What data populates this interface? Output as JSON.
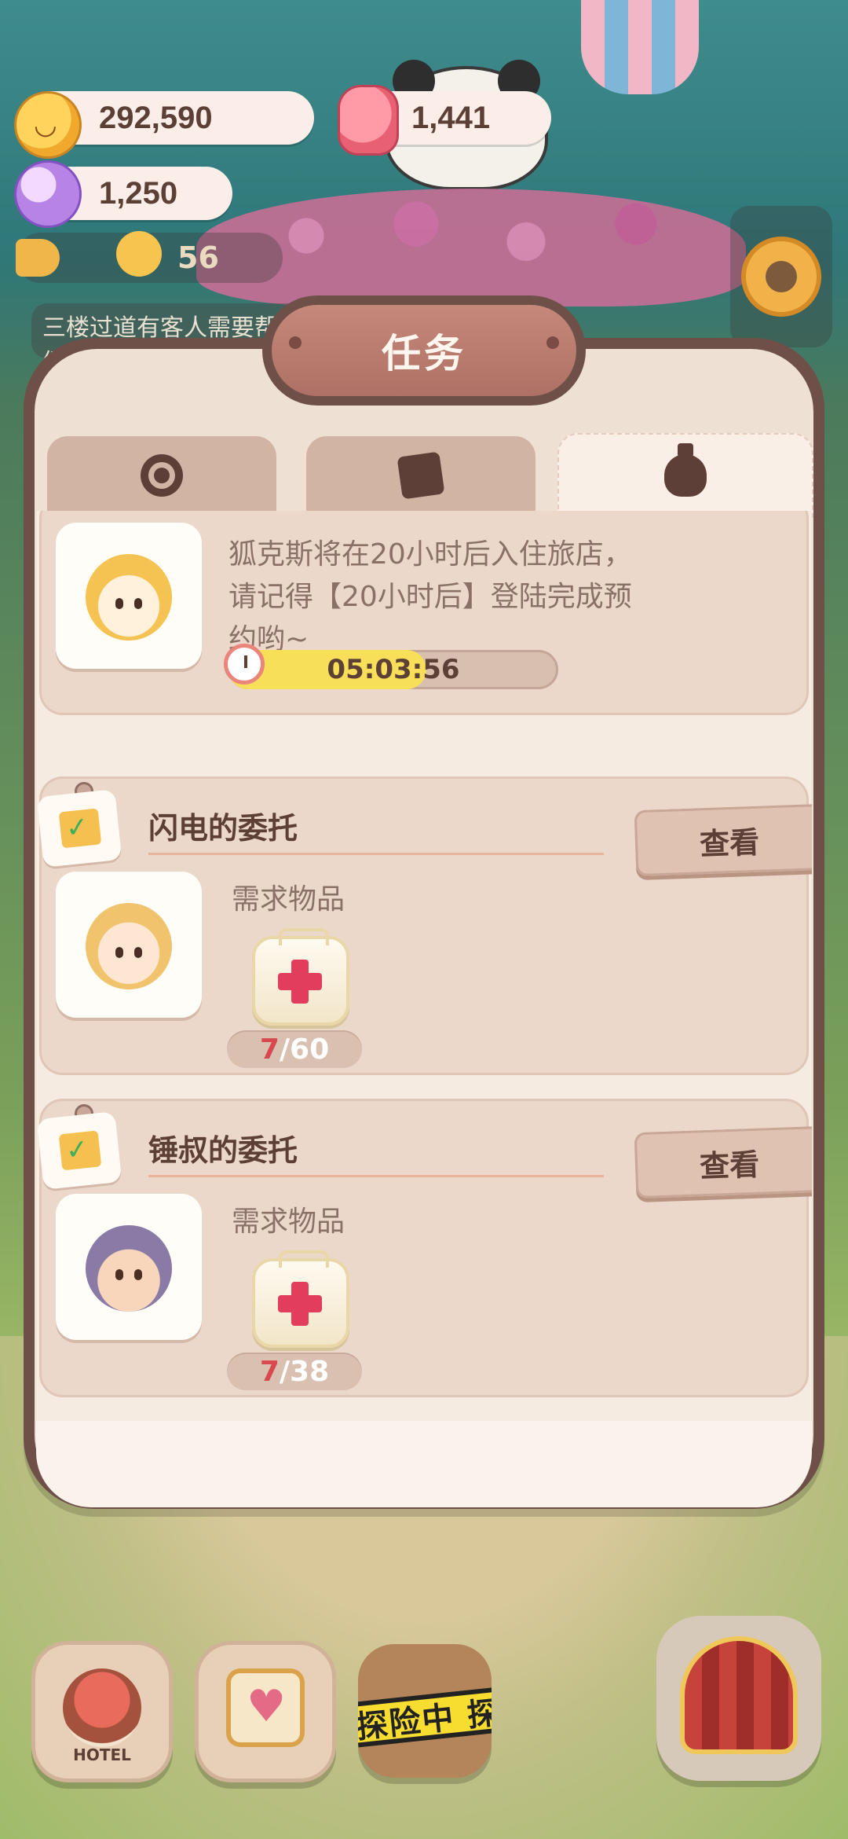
{
  "hud": {
    "cookies": "292,590",
    "jelly": "1,441",
    "gems": "1,250",
    "horn_count": "56",
    "notice_line1": "三楼过道有客人需要帮",
    "notice_line2": "促"
  },
  "panel": {
    "title": "任务",
    "tabs": [
      {
        "icon": "badge-icon",
        "active": false
      },
      {
        "icon": "note-icon",
        "active": false
      },
      {
        "icon": "bottle-icon",
        "active": true
      }
    ]
  },
  "tasks": [
    {
      "avatar": "fox-avatar",
      "description": "狐克斯将在20小时后入住旅店，请记得【20小时后】登陆完成预约哟~",
      "timer": "05:03:56",
      "timer_progress": 0.6
    },
    {
      "title": "闪电的委托",
      "view_label": "查看",
      "required_label": "需求物品",
      "item": "first-aid-kit-icon",
      "current": "7",
      "total": "/60",
      "avatar": "girl-avatar"
    },
    {
      "title": "锤叔的委托",
      "view_label": "查看",
      "required_label": "需求物品",
      "item": "first-aid-kit-icon",
      "current": "7",
      "total": "/38",
      "avatar": "uncle-avatar"
    }
  ],
  "nav": {
    "hotel_label": "HOTEL",
    "explore_label": "探险中 探"
  },
  "colors": {
    "panel_border": "#6e5048",
    "panel_bg": "#efe0d4",
    "accent_red": "#d8484e",
    "timer_fill": "#f7df5a"
  }
}
